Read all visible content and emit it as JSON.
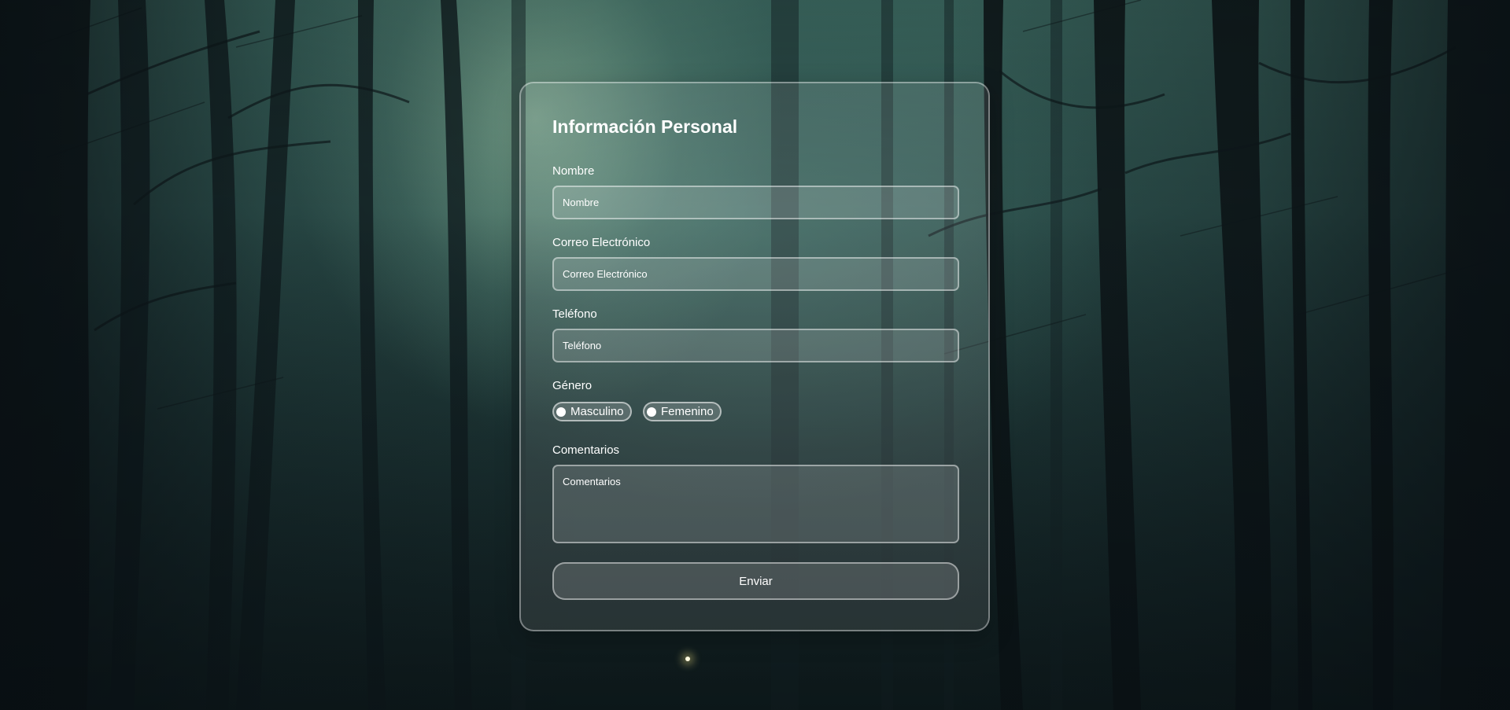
{
  "form": {
    "title": "Información Personal",
    "fields": {
      "nombre": {
        "label": "Nombre",
        "placeholder": "Nombre"
      },
      "correo": {
        "label": "Correo Electrónico",
        "placeholder": "Correo Electrónico"
      },
      "telefono": {
        "label": "Teléfono",
        "placeholder": "Teléfono"
      },
      "comentarios": {
        "label": "Comentarios",
        "placeholder": "Comentarios"
      }
    },
    "genero": {
      "label": "Género",
      "options": [
        "Masculino",
        "Femenino"
      ]
    },
    "submit_label": "Enviar"
  },
  "colors": {
    "text": "#ffffff",
    "card_border": "rgba(255,255,255,0.38)",
    "background_dark": "#142424",
    "background_light": "#3d6b63"
  }
}
